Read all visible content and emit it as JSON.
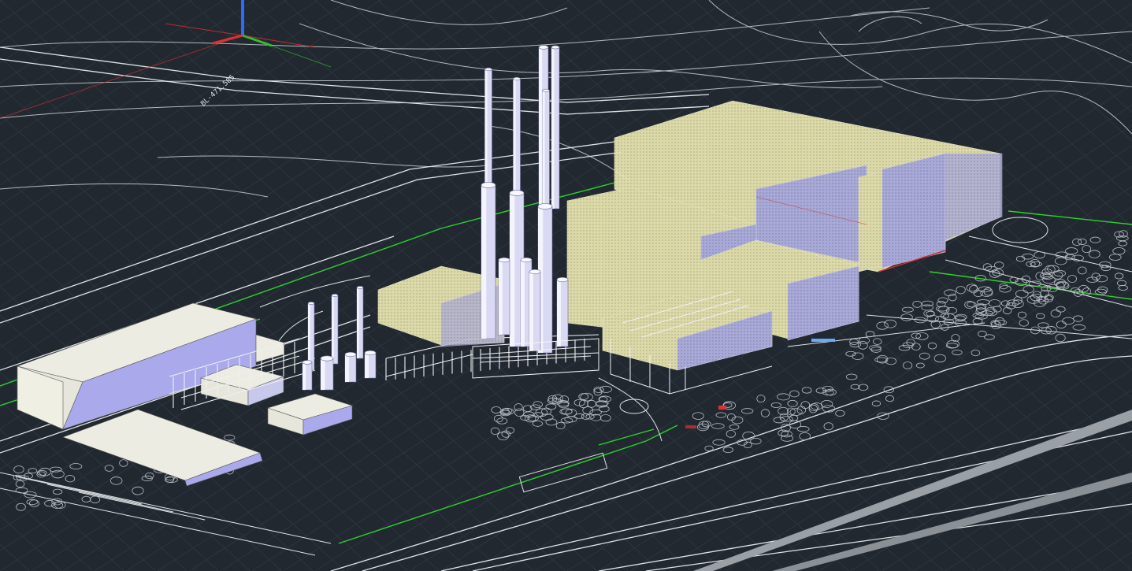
{
  "viewport": {
    "background": "#212830",
    "grid_color": "#2e3640",
    "linework_color": "#c8cdd2",
    "boundary_color": "#2fd02f",
    "translucent_fill": "#eeeab8",
    "solid_fill": "#e8e8dc",
    "side_fill": "#a8a8e8"
  },
  "ucs_icon": {
    "x_axis_color": "#e03030",
    "y_axis_color": "#30c030",
    "z_axis_color": "#2a6cff"
  },
  "road_label": "BL-471.585"
}
